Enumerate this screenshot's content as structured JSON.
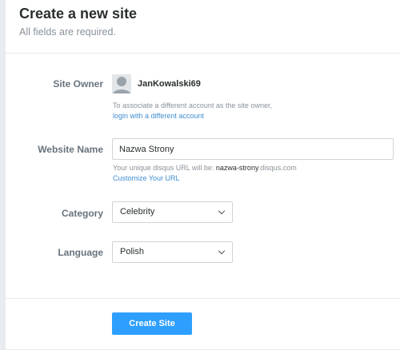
{
  "header": {
    "title": "Create a new site",
    "subtitle": "All fields are required."
  },
  "owner": {
    "label": "Site Owner",
    "username": "JanKowalski69",
    "help": "To associate a different account as the site owner,",
    "link": "login with a different account"
  },
  "website": {
    "label": "Website Name",
    "value": "Nazwa Strony",
    "hint_prefix": "Your unique disqus URL will be: ",
    "hint_slug": "nazwa-strony",
    "hint_suffix": ".disqus.com",
    "link": "Customize Your URL"
  },
  "category": {
    "label": "Category",
    "value": "Celebrity"
  },
  "language": {
    "label": "Language",
    "value": "Polish"
  },
  "submit": {
    "label": "Create Site"
  },
  "colors": {
    "accent": "#2e9fff",
    "link": "#3e8ed0"
  }
}
